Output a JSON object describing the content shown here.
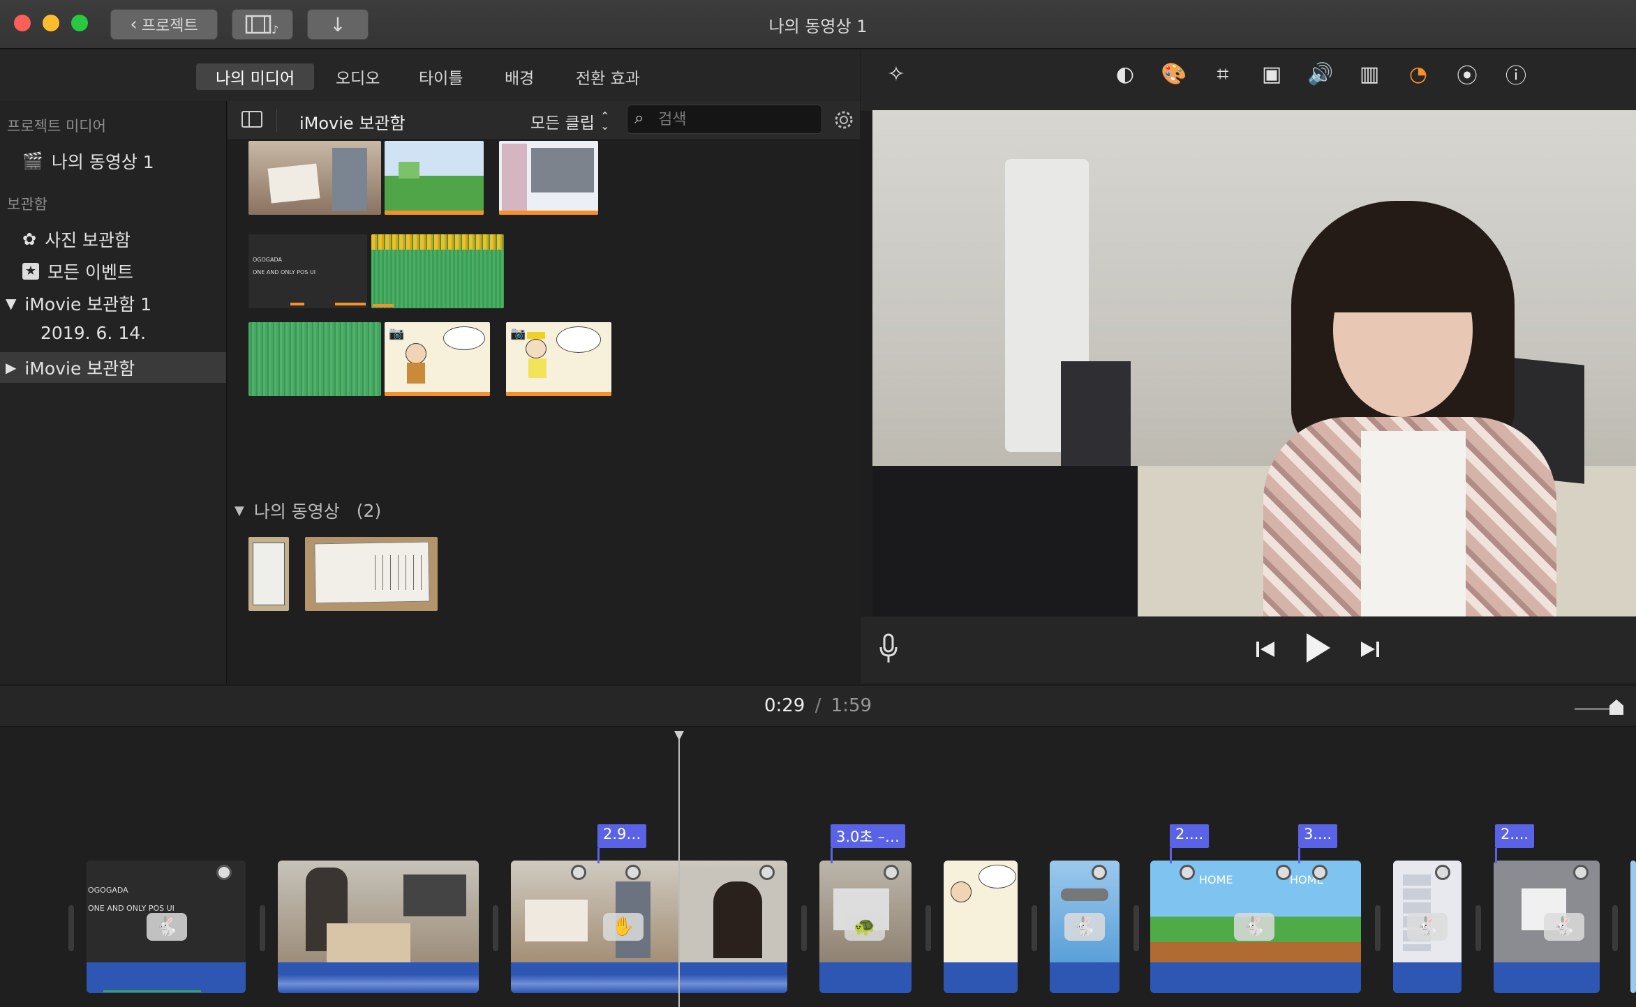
{
  "window": {
    "title": "나의 동영상 1"
  },
  "toolbar": {
    "back_label": "프로젝트"
  },
  "tabs": [
    {
      "label": "나의 미디어",
      "active": true
    },
    {
      "label": "오디오"
    },
    {
      "label": "타이틀"
    },
    {
      "label": "배경"
    },
    {
      "label": "전환 효과"
    }
  ],
  "sidebar": {
    "project_media_heading": "프로젝트 미디어",
    "project_item": "나의 동영상 1",
    "libraries_heading": "보관함",
    "photos_library": "사진 보관함",
    "all_events": "모든 이벤트",
    "library1": "iMovie 보관함 1",
    "library1_event": "2019. 6. 14.",
    "library2": "iMovie 보관함"
  },
  "browser": {
    "title": "iMovie 보관함",
    "filter": "모든 클립",
    "search_placeholder": "검색",
    "thumb_text_1": "OGOGADA",
    "thumb_text_2": "ONE AND ONLY POS UI",
    "section_label": "나의 동영상",
    "section_count": "(2)"
  },
  "timeline": {
    "current_time": "0:29",
    "separator": "/",
    "total_time": "1:59",
    "clip_texts": [
      "OGOGADA",
      "ONE AND ONLY POS UI"
    ],
    "tags": [
      "2.9…",
      "3.0초 –…",
      "2....",
      "3....",
      "2...."
    ]
  },
  "colors": {
    "accent_orange": "#f5902a",
    "audio_blue": "#2e56b3",
    "tag_purple": "#5a63e6",
    "volume_blue": "#3a8ee6"
  }
}
